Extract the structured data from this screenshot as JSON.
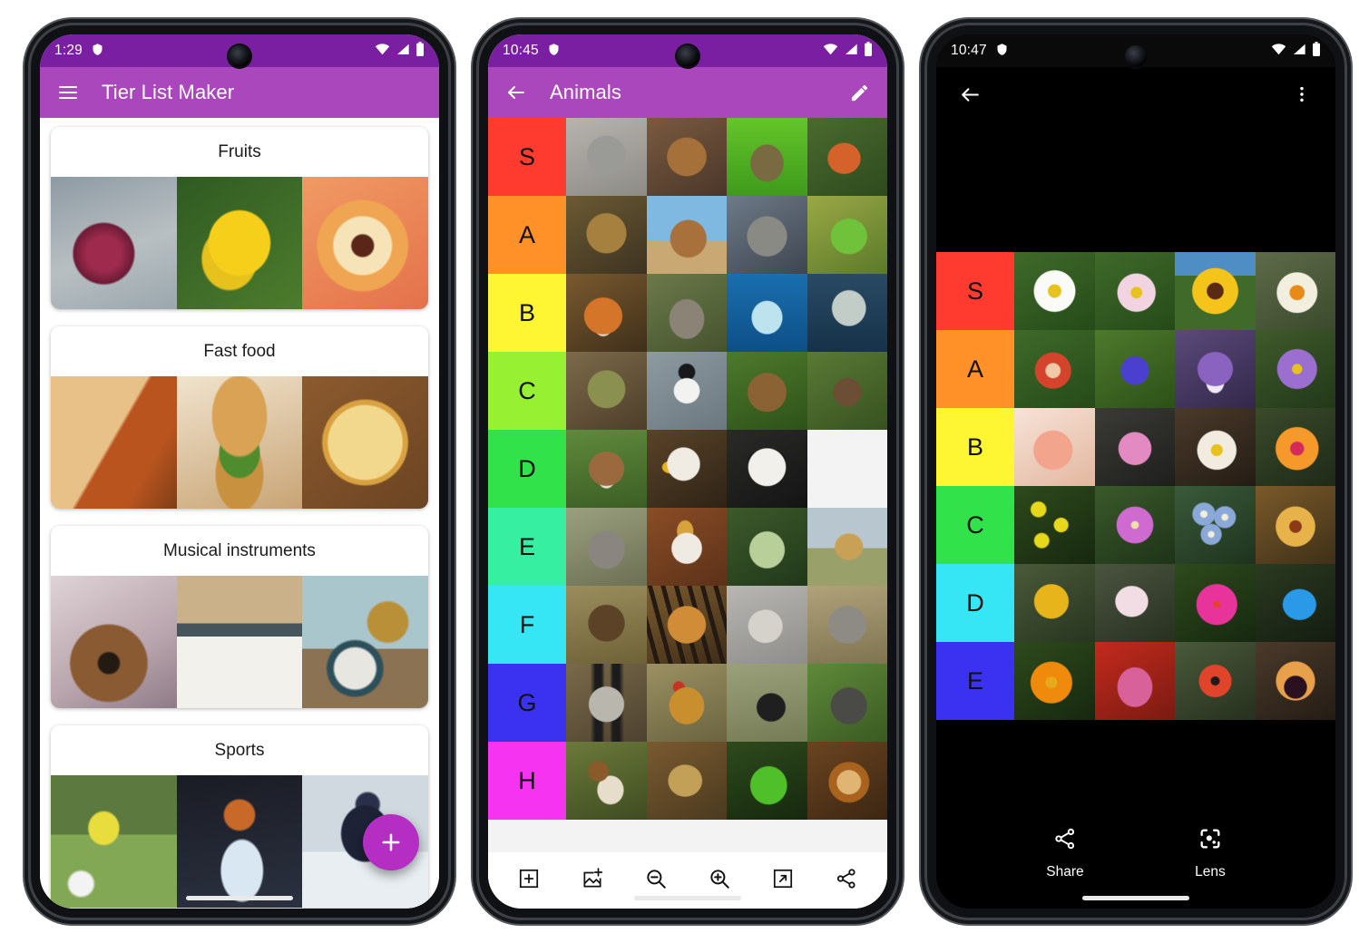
{
  "phone1": {
    "statusbar": {
      "time": "1:29",
      "vpn_icon": "shield-icon",
      "wifi_icon": "wifi-icon",
      "signal_icon": "signal-icon",
      "battery_icon": "battery-icon"
    },
    "appbar": {
      "menu_icon": "hamburger-menu-icon",
      "title": "Tier List Maker",
      "bg": "#AB47BC",
      "statusbar_bg": "#7B1FA2"
    },
    "fab": {
      "icon": "plus-icon",
      "color": "#B42EC4"
    },
    "cards": [
      {
        "title": "Fruits",
        "thumbs": [
          "apple",
          "bananas",
          "peach"
        ]
      },
      {
        "title": "Fast food",
        "thumbs": [
          "burrito",
          "hamburger",
          "pizza"
        ]
      },
      {
        "title": "Musical instruments",
        "thumbs": [
          "guitar",
          "piano",
          "drums"
        ]
      },
      {
        "title": "Sports",
        "thumbs": [
          "soccer",
          "basketball",
          "hockey"
        ]
      }
    ]
  },
  "phone2": {
    "statusbar": {
      "time": "10:45",
      "vpn_icon": "shield-icon",
      "wifi_icon": "wifi-icon",
      "signal_icon": "signal-icon",
      "battery_icon": "battery-icon"
    },
    "appbar": {
      "back_icon": "back-arrow-icon",
      "title": "Animals",
      "edit_icon": "pencil-edit-icon",
      "bg": "#AB47BC",
      "statusbar_bg": "#7B1FA2"
    },
    "tiers": [
      {
        "label": "S",
        "color": "#FF3B30",
        "items": [
          "dog",
          "cat",
          "rabbit",
          "squirrel"
        ]
      },
      {
        "label": "A",
        "color": "#FF9128",
        "items": [
          "owl",
          "camel",
          "wolf",
          "frog"
        ]
      },
      {
        "label": "B",
        "color": "#FFF633",
        "items": [
          "fox",
          "goat",
          "dolphin",
          "shark"
        ]
      },
      {
        "label": "C",
        "color": "#97F032",
        "items": [
          "crocodile",
          "penguin",
          "bear",
          "bat"
        ]
      },
      {
        "label": "D",
        "color": "#32E24A",
        "items": [
          "cow",
          "eagle",
          "panda",
          "deer"
        ]
      },
      {
        "label": "E",
        "color": "#36EFA0",
        "items": [
          "rhino",
          "horse",
          "octopus",
          "giraffe"
        ]
      },
      {
        "label": "F",
        "color": "#36E6F5",
        "items": [
          "bison",
          "tiger",
          "rat",
          "elephant"
        ]
      },
      {
        "label": "G",
        "color": "#3A32F0",
        "items": [
          "raccoon",
          "chicken",
          "ostrich",
          "gorilla"
        ]
      },
      {
        "label": "H",
        "color": "#F633F0",
        "items": [
          "snail",
          "lizard",
          "snake",
          "lion"
        ]
      }
    ],
    "toolbar": [
      {
        "name": "add-row-button",
        "icon": "box-plus-icon"
      },
      {
        "name": "add-image-button",
        "icon": "image-plus-icon"
      },
      {
        "name": "zoom-out-button",
        "icon": "zoom-out-icon"
      },
      {
        "name": "zoom-in-button",
        "icon": "zoom-in-icon"
      },
      {
        "name": "open-external-button",
        "icon": "open-external-icon"
      },
      {
        "name": "share-button",
        "icon": "share-icon"
      }
    ]
  },
  "phone3": {
    "statusbar": {
      "time": "10:47",
      "vpn_icon": "shield-icon",
      "wifi_icon": "wifi-icon",
      "signal_icon": "signal-icon",
      "battery_icon": "battery-icon"
    },
    "appbar": {
      "back_icon": "back-arrow-icon",
      "overflow_icon": "more-vertical-icon",
      "bg": "#000000"
    },
    "tiers": [
      {
        "label": "S",
        "color": "#FF3B30",
        "items": [
          "daisy",
          "anemone",
          "sunflower",
          "narcissus"
        ]
      },
      {
        "label": "A",
        "color": "#FF9128",
        "items": [
          "rose",
          "hyacinth",
          "iris",
          "aster"
        ]
      },
      {
        "label": "B",
        "color": "#FFF633",
        "items": [
          "bougainvillea",
          "carnation",
          "waterlily",
          "chrysanthemum"
        ]
      },
      {
        "label": "C",
        "color": "#32E24A",
        "items": [
          "mimosa",
          "orchid",
          "forgetmenot",
          "daylily"
        ]
      },
      {
        "label": "D",
        "color": "#36E6F5",
        "items": [
          "dandelion",
          "cyclamen",
          "periwinkle",
          "scilla"
        ]
      },
      {
        "label": "E",
        "color": "#3A32F0",
        "items": [
          "calendula",
          "tulip",
          "poppy",
          "pansy"
        ]
      }
    ],
    "actions": [
      {
        "label": "Share",
        "icon": "share-icon"
      },
      {
        "label": "Lens",
        "icon": "google-lens-icon"
      }
    ]
  }
}
